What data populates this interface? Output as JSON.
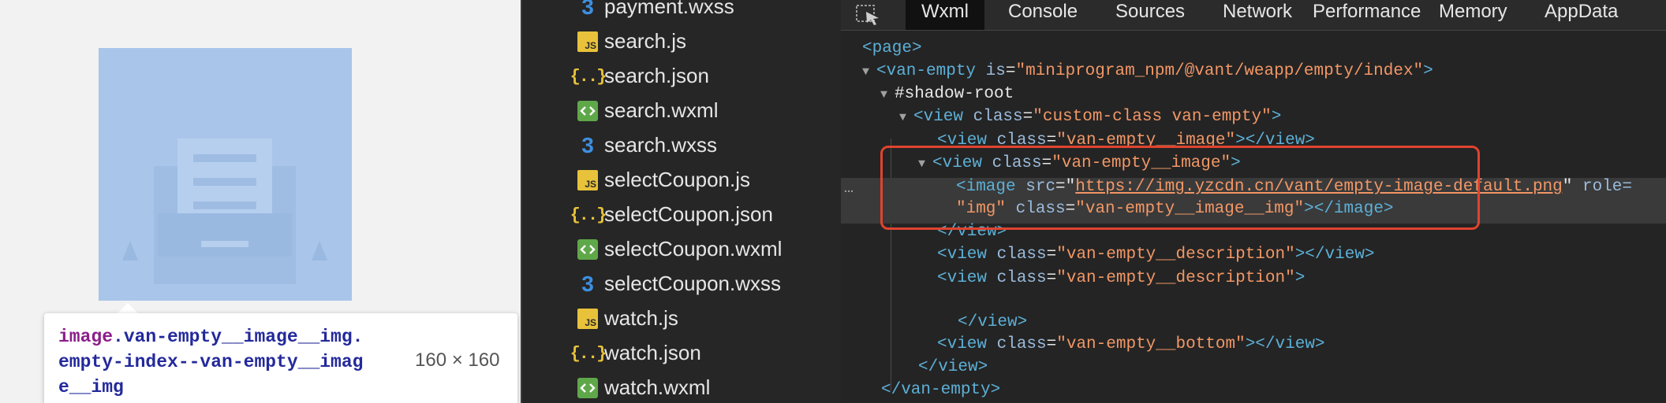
{
  "tooltip": {
    "tag": "image",
    "selector_rest": ".van-empty__image__img.empty-index--van-empty__image__img",
    "size": "160 × 160"
  },
  "file_tree": {
    "files": [
      {
        "name": "payment.wxss",
        "type": "wxss"
      },
      {
        "name": "search.js",
        "type": "js"
      },
      {
        "name": "search.json",
        "type": "json"
      },
      {
        "name": "search.wxml",
        "type": "wxml"
      },
      {
        "name": "search.wxss",
        "type": "wxss"
      },
      {
        "name": "selectCoupon.js",
        "type": "js"
      },
      {
        "name": "selectCoupon.json",
        "type": "json"
      },
      {
        "name": "selectCoupon.wxml",
        "type": "wxml"
      },
      {
        "name": "selectCoupon.wxss",
        "type": "wxss"
      },
      {
        "name": "watch.js",
        "type": "js"
      },
      {
        "name": "watch.json",
        "type": "json"
      },
      {
        "name": "watch.wxml",
        "type": "wxml"
      }
    ]
  },
  "devtools": {
    "tabs": [
      "Wxml",
      "Console",
      "Sources",
      "Network",
      "Performance",
      "Memory",
      "AppData"
    ],
    "active_tab": "Wxml",
    "tree": {
      "page_open": "<page>",
      "van_empty_open": "<van-empty is=\"miniprogram_npm/@vant/weapp/empty/index\">",
      "van_empty_tag": "<van-empty",
      "van_empty_attr": "is",
      "van_empty_val": "\"miniprogram_npm/@vant/weapp/empty/index\"",
      "shadow_root": "#shadow-root",
      "view_root_attr_val": "\"custom-class van-empty\"",
      "view_image_val": "\"van-empty__image\"",
      "image_src": "https://img.yzcdn.cn/vant/empty-image-default.png",
      "image_role_partial": "role=",
      "image_role_val": "\"img\"",
      "image_class_val": "\"van-empty__image__img\"",
      "view_desc_val": "\"van-empty__description\"",
      "view_bottom_val": "\"van-empty__bottom\"",
      "close_view": "</view>",
      "close_image": "></image>",
      "close_van_empty": "</van-empty>",
      "tag_view": "<view",
      "tag_image": "<image",
      "attr_class": "class",
      "attr_src": "src",
      "open_close_view": "></view>",
      "gt": ">",
      "eq": "="
    },
    "ellipsis": "…"
  },
  "colors": {
    "highlight": "#a9c5e9",
    "red_box": "#e0432f",
    "tag_blue": "#5db0d7",
    "attr_value_orange": "#f29766"
  }
}
